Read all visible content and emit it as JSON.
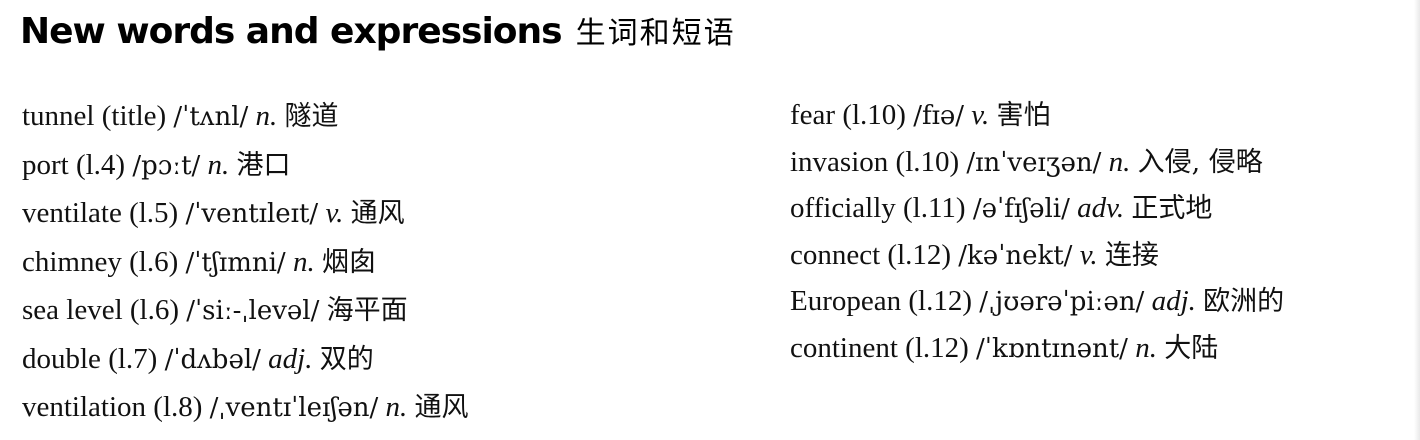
{
  "heading": {
    "english": "New words and expressions",
    "chinese": "生词和短语"
  },
  "left_column": [
    {
      "word": "tunnel",
      "ref": "(title)",
      "phonetic": "/ˈtʌnl/",
      "pos": "n.",
      "meaning": "隧道"
    },
    {
      "word": "port",
      "ref": "(l.4)",
      "phonetic": "/pɔːt/",
      "pos": "n.",
      "meaning": "港口"
    },
    {
      "word": "ventilate",
      "ref": "(l.5)",
      "phonetic": "/ˈventɪleɪt/",
      "pos": "v.",
      "meaning": "通风"
    },
    {
      "word": "chimney",
      "ref": "(l.6)",
      "phonetic": "/ˈtʃɪmni/",
      "pos": "n.",
      "meaning": "烟囱"
    },
    {
      "word": "sea level",
      "ref": "(l.6)",
      "phonetic": "/ˈsiː-ˌlevəl/",
      "pos": "",
      "meaning": "海平面"
    },
    {
      "word": "double",
      "ref": "(l.7)",
      "phonetic": "/ˈdʌbəl/",
      "pos": "adj.",
      "meaning": "双的"
    },
    {
      "word": "ventilation",
      "ref": "(l.8)",
      "phonetic": "/ˌventɪˈleɪʃən/",
      "pos": "n.",
      "meaning": "通风"
    }
  ],
  "right_column": [
    {
      "word": "fear",
      "ref": "(l.10)",
      "phonetic": "/fɪə/",
      "pos": "v.",
      "meaning": "害怕"
    },
    {
      "word": "invasion",
      "ref": "(l.10)",
      "phonetic": "/ɪnˈveɪʒən/",
      "pos": "n.",
      "meaning": "入侵, 侵略"
    },
    {
      "word": "officially",
      "ref": "(l.11)",
      "phonetic": "/əˈfɪʃəli/",
      "pos": "adv.",
      "meaning": "正式地"
    },
    {
      "word": "connect",
      "ref": "(l.12)",
      "phonetic": "/kəˈnekt/",
      "pos": "v.",
      "meaning": "连接"
    },
    {
      "word": "European",
      "ref": "(l.12)",
      "phonetic": "/ˌjʊərəˈpiːən/",
      "pos": "adj.",
      "meaning": "欧洲的"
    },
    {
      "word": "continent",
      "ref": "(l.12)",
      "phonetic": "/ˈkɒntɪnənt/",
      "pos": "n.",
      "meaning": "大陆"
    }
  ]
}
